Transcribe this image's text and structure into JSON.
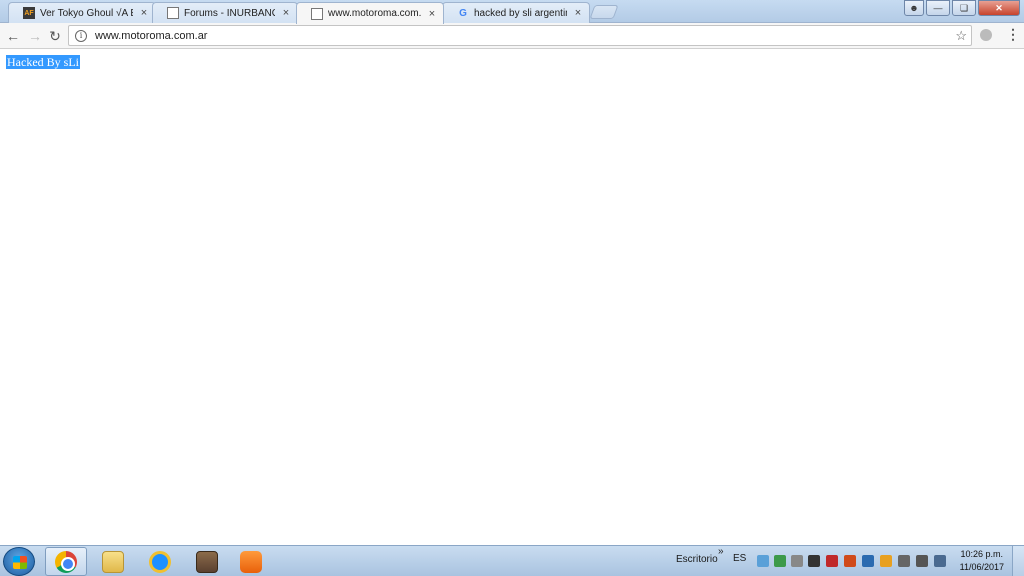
{
  "tabs": [
    {
      "title": "Ver Tokyo Ghoul √A Epis",
      "favicon": "AF",
      "close": "×"
    },
    {
      "title": "Forums - INURBANOS: G",
      "favicon": "",
      "close": "×"
    },
    {
      "title": "www.motoroma.com.ar",
      "favicon": "",
      "close": "×"
    },
    {
      "title": "hacked by sli argentina -",
      "favicon": "G",
      "close": "×"
    }
  ],
  "toolbar": {
    "back": "←",
    "forward": "→",
    "reload": "↻",
    "url": "www.motoroma.com.ar",
    "info": "i",
    "star": "☆",
    "menu": "⋮"
  },
  "page": {
    "text": "Hacked By sLi"
  },
  "taskbar": {
    "escritorio": "Escritorio",
    "chevron": "»",
    "lang": "ES",
    "time": "10:26 p.m.",
    "date": "11/06/2017"
  },
  "colors": {
    "selection": "#3399ff",
    "close_button": "#c7432c"
  }
}
